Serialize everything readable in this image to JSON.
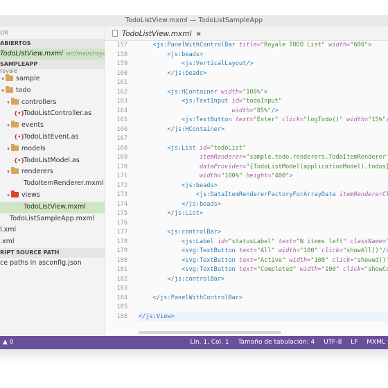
{
  "window": {
    "title": "TodoListView.mxml — TodoListSampleApp"
  },
  "sidebar": {
    "header": "OR",
    "open_editors_label": "ABIERTOS",
    "open_file": {
      "name": "TodoListView.mxml",
      "path": "src/main/royale/..."
    },
    "project_label": "SAMPLEAPP",
    "cut_label": "royale",
    "tree": [
      {
        "label": "sample",
        "kind": "folder",
        "indent": 0
      },
      {
        "label": "todo",
        "kind": "folder",
        "indent": 1
      },
      {
        "label": "controllers",
        "kind": "folder",
        "indent": 2
      },
      {
        "label": "TodoListController.as",
        "kind": "as",
        "indent": 3
      },
      {
        "label": "events",
        "kind": "folder",
        "indent": 2
      },
      {
        "label": "TodoListEvent.as",
        "kind": "as",
        "indent": 3
      },
      {
        "label": "models",
        "kind": "folder",
        "indent": 2
      },
      {
        "label": "TodoListModel.as",
        "kind": "as",
        "indent": 3
      },
      {
        "label": "renderers",
        "kind": "folder",
        "indent": 2
      },
      {
        "label": "TodoItemRenderer.mxml",
        "kind": "mxml",
        "indent": 3
      },
      {
        "label": "views",
        "kind": "folder-red",
        "indent": 2
      },
      {
        "label": "TodoListView.mxml",
        "kind": "mxml",
        "indent": 3,
        "selected": true
      },
      {
        "label": "TodoListSampleApp.mxml",
        "kind": "mxml",
        "indent": 0
      },
      {
        "label": "l.xml",
        "kind": "plain",
        "indent": 0
      },
      {
        "label": ".xml",
        "kind": "plain",
        "indent": 0
      }
    ],
    "script_section_label": "RIPT SOURCE PATH",
    "script_item": "ce paths in asconfig.json"
  },
  "editor": {
    "tab_label": "TodoListView.mxml",
    "tab_close": "×",
    "line_numbers": [
      "157",
      "158",
      "159",
      "160",
      "161",
      "162",
      "163",
      "164",
      "165",
      "166",
      "167",
      "168",
      "169",
      "170",
      "171",
      "172",
      "173",
      "174",
      "175",
      "176",
      "177",
      "178",
      "179",
      "180",
      "181",
      "182",
      "183",
      "184",
      "185",
      "186"
    ]
  },
  "statusbar": {
    "problems": "▲ 0",
    "position": "Lín. 1, Col. 1",
    "tab_size": "Tamaño de tabulación: 4",
    "encoding": "UTF-8",
    "eol": "LF",
    "language": "MXML"
  },
  "colors": {
    "accent": "#6a4f9b",
    "selection": "#cfe6c6",
    "tag": "#2d7bb6",
    "attribute": "#a65ea0",
    "string": "#4e8c3a"
  }
}
